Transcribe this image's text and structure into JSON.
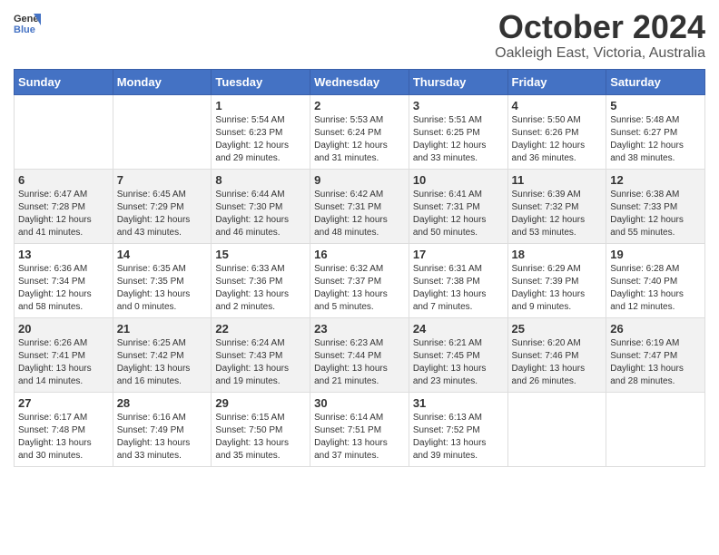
{
  "header": {
    "logo_line1": "General",
    "logo_line2": "Blue",
    "month_title": "October 2024",
    "location": "Oakleigh East, Victoria, Australia"
  },
  "days_of_week": [
    "Sunday",
    "Monday",
    "Tuesday",
    "Wednesday",
    "Thursday",
    "Friday",
    "Saturday"
  ],
  "weeks": [
    [
      {
        "day": "",
        "info": ""
      },
      {
        "day": "",
        "info": ""
      },
      {
        "day": "1",
        "info": "Sunrise: 5:54 AM\nSunset: 6:23 PM\nDaylight: 12 hours and 29 minutes."
      },
      {
        "day": "2",
        "info": "Sunrise: 5:53 AM\nSunset: 6:24 PM\nDaylight: 12 hours and 31 minutes."
      },
      {
        "day": "3",
        "info": "Sunrise: 5:51 AM\nSunset: 6:25 PM\nDaylight: 12 hours and 33 minutes."
      },
      {
        "day": "4",
        "info": "Sunrise: 5:50 AM\nSunset: 6:26 PM\nDaylight: 12 hours and 36 minutes."
      },
      {
        "day": "5",
        "info": "Sunrise: 5:48 AM\nSunset: 6:27 PM\nDaylight: 12 hours and 38 minutes."
      }
    ],
    [
      {
        "day": "6",
        "info": "Sunrise: 6:47 AM\nSunset: 7:28 PM\nDaylight: 12 hours and 41 minutes."
      },
      {
        "day": "7",
        "info": "Sunrise: 6:45 AM\nSunset: 7:29 PM\nDaylight: 12 hours and 43 minutes."
      },
      {
        "day": "8",
        "info": "Sunrise: 6:44 AM\nSunset: 7:30 PM\nDaylight: 12 hours and 46 minutes."
      },
      {
        "day": "9",
        "info": "Sunrise: 6:42 AM\nSunset: 7:31 PM\nDaylight: 12 hours and 48 minutes."
      },
      {
        "day": "10",
        "info": "Sunrise: 6:41 AM\nSunset: 7:31 PM\nDaylight: 12 hours and 50 minutes."
      },
      {
        "day": "11",
        "info": "Sunrise: 6:39 AM\nSunset: 7:32 PM\nDaylight: 12 hours and 53 minutes."
      },
      {
        "day": "12",
        "info": "Sunrise: 6:38 AM\nSunset: 7:33 PM\nDaylight: 12 hours and 55 minutes."
      }
    ],
    [
      {
        "day": "13",
        "info": "Sunrise: 6:36 AM\nSunset: 7:34 PM\nDaylight: 12 hours and 58 minutes."
      },
      {
        "day": "14",
        "info": "Sunrise: 6:35 AM\nSunset: 7:35 PM\nDaylight: 13 hours and 0 minutes."
      },
      {
        "day": "15",
        "info": "Sunrise: 6:33 AM\nSunset: 7:36 PM\nDaylight: 13 hours and 2 minutes."
      },
      {
        "day": "16",
        "info": "Sunrise: 6:32 AM\nSunset: 7:37 PM\nDaylight: 13 hours and 5 minutes."
      },
      {
        "day": "17",
        "info": "Sunrise: 6:31 AM\nSunset: 7:38 PM\nDaylight: 13 hours and 7 minutes."
      },
      {
        "day": "18",
        "info": "Sunrise: 6:29 AM\nSunset: 7:39 PM\nDaylight: 13 hours and 9 minutes."
      },
      {
        "day": "19",
        "info": "Sunrise: 6:28 AM\nSunset: 7:40 PM\nDaylight: 13 hours and 12 minutes."
      }
    ],
    [
      {
        "day": "20",
        "info": "Sunrise: 6:26 AM\nSunset: 7:41 PM\nDaylight: 13 hours and 14 minutes."
      },
      {
        "day": "21",
        "info": "Sunrise: 6:25 AM\nSunset: 7:42 PM\nDaylight: 13 hours and 16 minutes."
      },
      {
        "day": "22",
        "info": "Sunrise: 6:24 AM\nSunset: 7:43 PM\nDaylight: 13 hours and 19 minutes."
      },
      {
        "day": "23",
        "info": "Sunrise: 6:23 AM\nSunset: 7:44 PM\nDaylight: 13 hours and 21 minutes."
      },
      {
        "day": "24",
        "info": "Sunrise: 6:21 AM\nSunset: 7:45 PM\nDaylight: 13 hours and 23 minutes."
      },
      {
        "day": "25",
        "info": "Sunrise: 6:20 AM\nSunset: 7:46 PM\nDaylight: 13 hours and 26 minutes."
      },
      {
        "day": "26",
        "info": "Sunrise: 6:19 AM\nSunset: 7:47 PM\nDaylight: 13 hours and 28 minutes."
      }
    ],
    [
      {
        "day": "27",
        "info": "Sunrise: 6:17 AM\nSunset: 7:48 PM\nDaylight: 13 hours and 30 minutes."
      },
      {
        "day": "28",
        "info": "Sunrise: 6:16 AM\nSunset: 7:49 PM\nDaylight: 13 hours and 33 minutes."
      },
      {
        "day": "29",
        "info": "Sunrise: 6:15 AM\nSunset: 7:50 PM\nDaylight: 13 hours and 35 minutes."
      },
      {
        "day": "30",
        "info": "Sunrise: 6:14 AM\nSunset: 7:51 PM\nDaylight: 13 hours and 37 minutes."
      },
      {
        "day": "31",
        "info": "Sunrise: 6:13 AM\nSunset: 7:52 PM\nDaylight: 13 hours and 39 minutes."
      },
      {
        "day": "",
        "info": ""
      },
      {
        "day": "",
        "info": ""
      }
    ]
  ]
}
